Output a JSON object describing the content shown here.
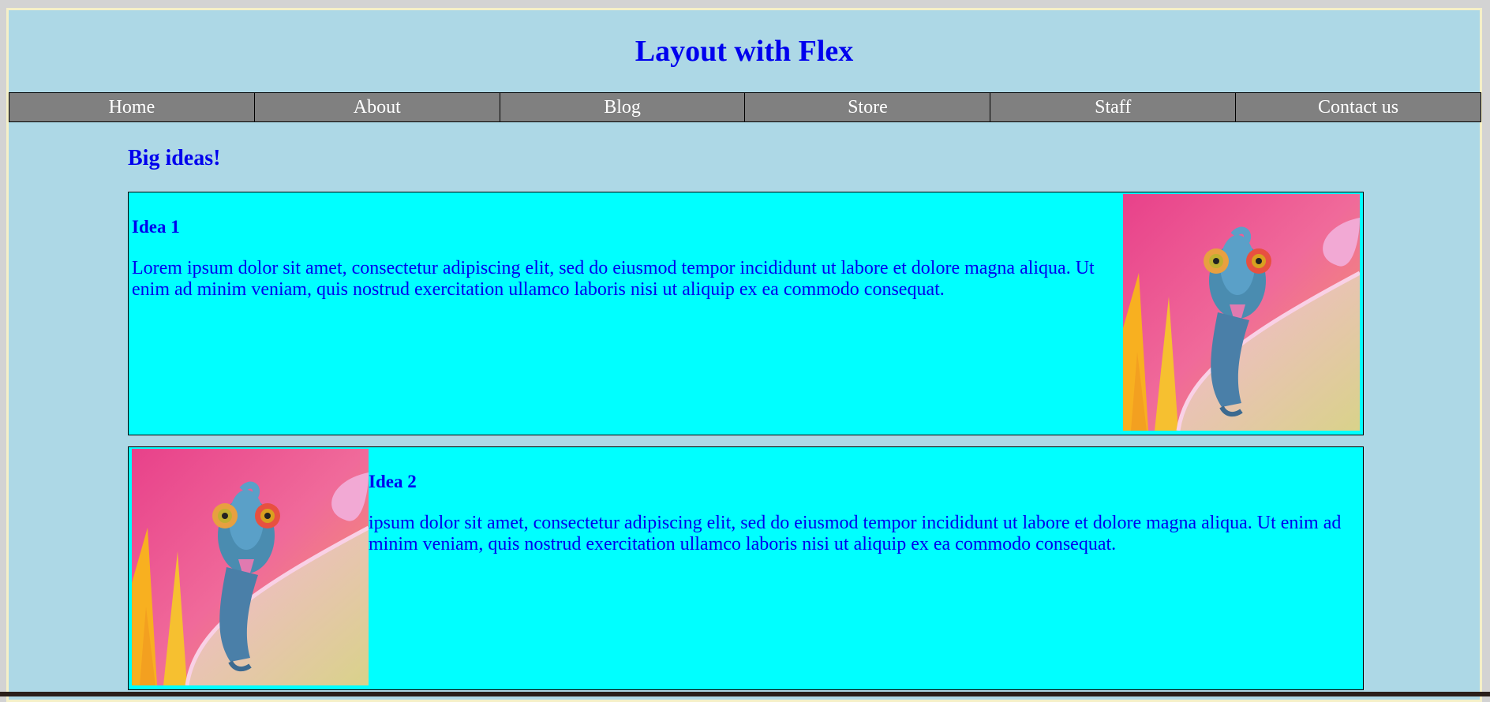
{
  "header": {
    "title": "Layout with Flex"
  },
  "nav": {
    "items": [
      {
        "label": "Home"
      },
      {
        "label": "About"
      },
      {
        "label": "Blog"
      },
      {
        "label": "Store"
      },
      {
        "label": "Staff"
      },
      {
        "label": "Contact us"
      }
    ]
  },
  "main": {
    "heading": "Big ideas!",
    "ideas": [
      {
        "title": "Idea 1",
        "text": "Lorem ipsum dolor sit amet, consectetur adipiscing elit, sed do eiusmod tempor incididunt ut labore et dolore magna aliqua. Ut enim ad minim veniam, quis nostrud exercitation ullamco laboris nisi ut aliquip ex ea commodo consequat.",
        "image": "chameleon-on-flower-image"
      },
      {
        "title": "Idea 2",
        "text": "ipsum dolor sit amet, consectetur adipiscing elit, sed do eiusmod tempor incididunt ut labore et dolore magna aliqua. Ut enim ad minim veniam, quis nostrud exercitation ullamco laboris nisi ut aliquip ex ea commodo consequat.",
        "image": "chameleon-on-flower-image"
      }
    ]
  },
  "colors": {
    "page_bg": "#add8e6",
    "title": "#0000ee",
    "nav_bg": "#808080",
    "idea_bg": "#00ffff"
  }
}
